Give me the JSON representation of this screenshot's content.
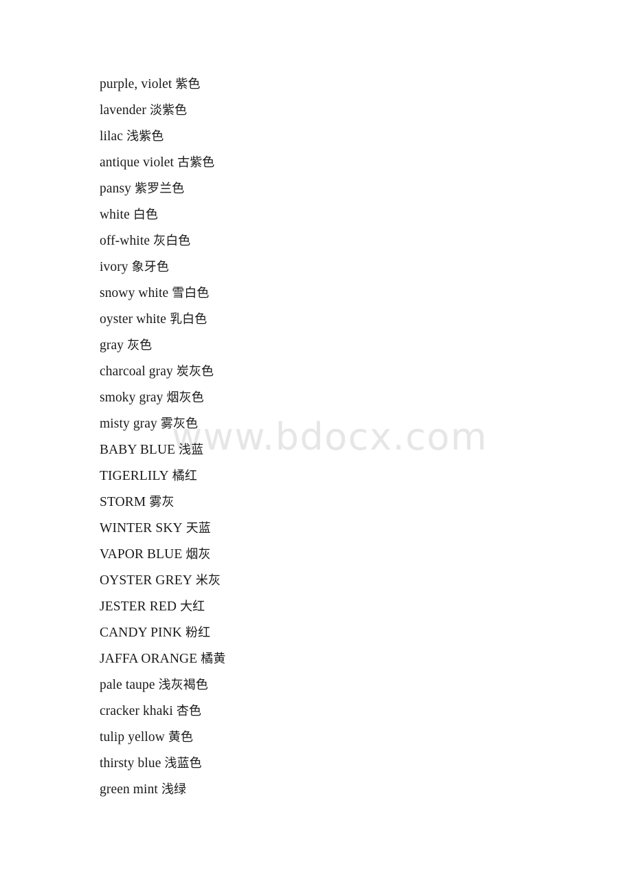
{
  "document": {
    "page_background": "#ffffff",
    "text_color": "#1a1a1a",
    "watermark": {
      "text": "www.bdocx.com",
      "color": "#e6e6e6"
    }
  },
  "glossary": {
    "entries": [
      {
        "term": "purple, violet",
        "chinese": "紫色"
      },
      {
        "term": "lavender",
        "chinese": "淡紫色"
      },
      {
        "term": "lilac",
        "chinese": "浅紫色"
      },
      {
        "term": "antique violet",
        "chinese": "古紫色"
      },
      {
        "term": "pansy",
        "chinese": "紫罗兰色"
      },
      {
        "term": "white",
        "chinese": "白色"
      },
      {
        "term": "off-white",
        "chinese": "灰白色"
      },
      {
        "term": "ivory",
        "chinese": "象牙色"
      },
      {
        "term": "snowy white",
        "chinese": "雪白色"
      },
      {
        "term": "oyster white",
        "chinese": "乳白色"
      },
      {
        "term": "gray",
        "chinese": "灰色"
      },
      {
        "term": "charcoal gray",
        "chinese": "炭灰色"
      },
      {
        "term": "smoky gray",
        "chinese": "烟灰色"
      },
      {
        "term": "misty gray",
        "chinese": "雾灰色"
      },
      {
        "term": "BABY BLUE",
        "chinese": "浅蓝"
      },
      {
        "term": "TIGERLILY",
        "chinese": "橘红"
      },
      {
        "term": "STORM",
        "chinese": "雾灰"
      },
      {
        "term": "WINTER SKY",
        "chinese": "天蓝"
      },
      {
        "term": "VAPOR BLUE",
        "chinese": "烟灰"
      },
      {
        "term": "OYSTER GREY",
        "chinese": "米灰"
      },
      {
        "term": "JESTER RED",
        "chinese": "大红"
      },
      {
        "term": "CANDY PINK",
        "chinese": "粉红"
      },
      {
        "term": "JAFFA ORANGE",
        "chinese": "橘黄"
      },
      {
        "term": "pale taupe",
        "chinese": "浅灰褐色"
      },
      {
        "term": "cracker khaki",
        "chinese": "杏色"
      },
      {
        "term": "tulip yellow",
        "chinese": "黄色"
      },
      {
        "term": "thirsty blue",
        "chinese": "浅蓝色"
      },
      {
        "term": "green mint",
        "chinese": "浅绿"
      }
    ]
  }
}
